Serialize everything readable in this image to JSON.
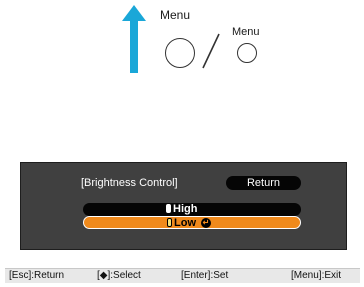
{
  "instruction": {
    "menu_label_large": "Menu",
    "menu_label_small": "Menu",
    "arrow_color": "#1aa7d8"
  },
  "osd": {
    "title": "[Brightness Control]",
    "return_label": "Return",
    "options": [
      {
        "label": "High",
        "selected": false
      },
      {
        "label": "Low",
        "selected": true
      }
    ],
    "enter_icon": "enter-icon",
    "highlight_color": "#f08a1c"
  },
  "status_bar": {
    "esc": "[Esc]:Return",
    "select": "[◆]:Select",
    "enter": "[Enter]:Set",
    "menu": "[Menu]:Exit"
  }
}
